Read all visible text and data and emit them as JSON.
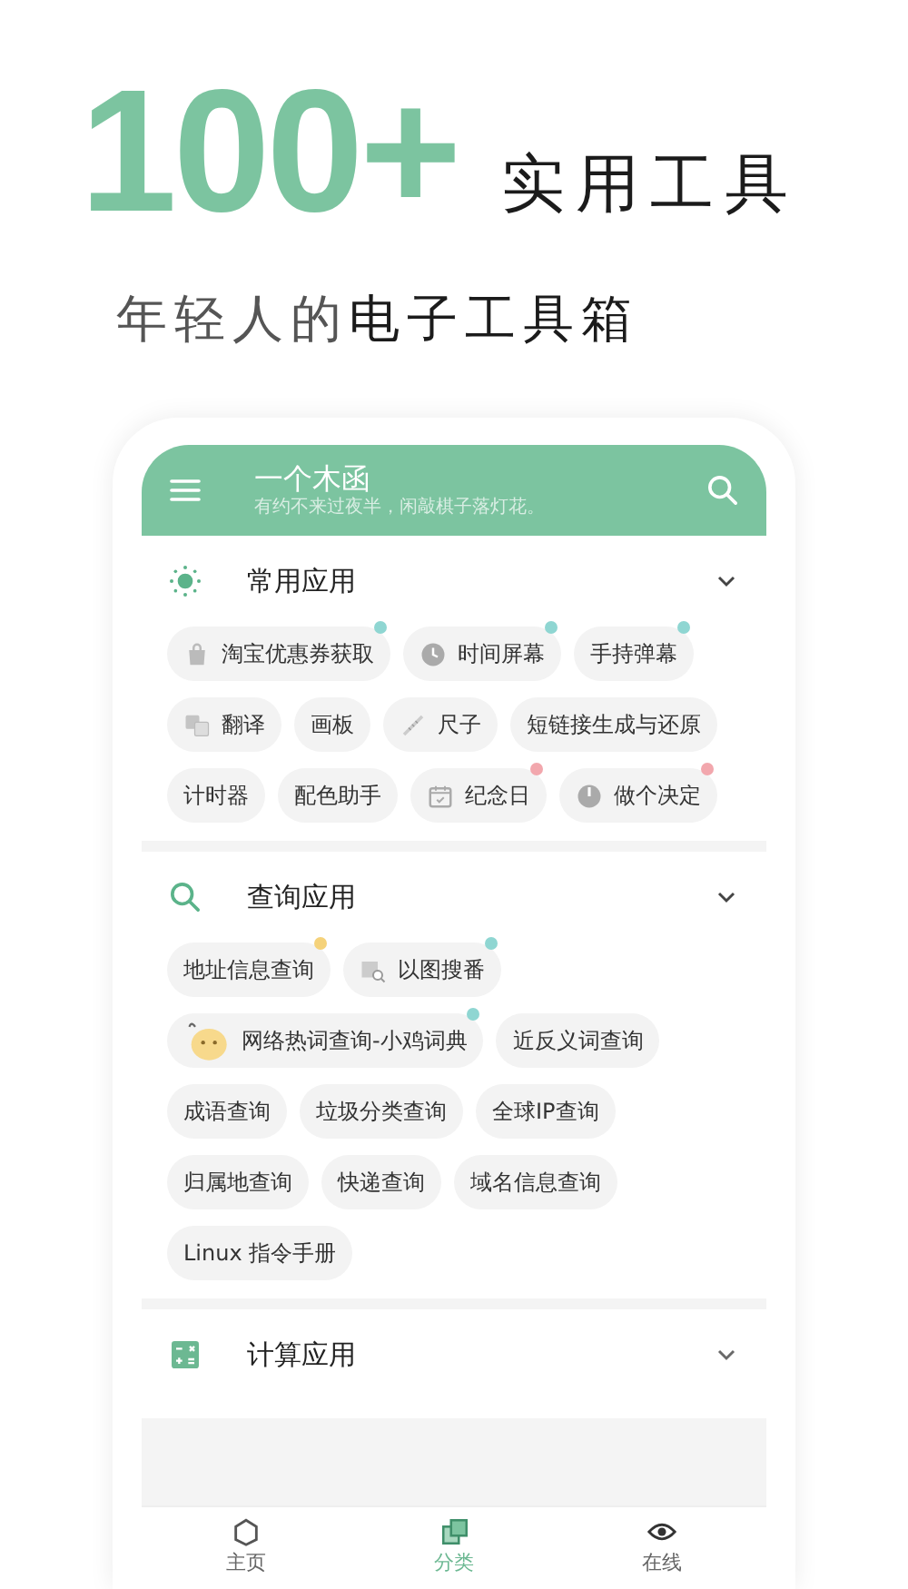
{
  "headline": {
    "number": "100+",
    "caption": "实用工具"
  },
  "subtitle": {
    "muted": "年轻人的",
    "strong": "电子工具箱"
  },
  "app_bar": {
    "title": "一个木函",
    "motto": "有约不来过夜半，闲敲棋子落灯花。"
  },
  "sections": [
    {
      "kind": "sun",
      "title": "常用应用",
      "expanded": true,
      "chips": [
        {
          "label": "淘宝优惠券获取",
          "kind": "bag",
          "color": "#8fd6d2"
        },
        {
          "label": "时间屏幕",
          "kind": "clock",
          "color": "#8fd6d2"
        },
        {
          "label": "手持弹幕",
          "kind": "plain",
          "color": "#8fd6d2"
        },
        {
          "label": "翻译",
          "kind": "translate"
        },
        {
          "label": "画板",
          "kind": "plain"
        },
        {
          "label": "尺子",
          "kind": "ruler"
        },
        {
          "label": "短链接生成与还原",
          "kind": "plain"
        },
        {
          "label": "计时器",
          "kind": "plain"
        },
        {
          "label": "配色助手",
          "kind": "plain"
        },
        {
          "label": "纪念日",
          "kind": "calendar",
          "color": "#f2a7ad"
        },
        {
          "label": "做个决定",
          "kind": "dial",
          "color": "#f2a7ad"
        }
      ]
    },
    {
      "kind": "search",
      "title": "查询应用",
      "expanded": true,
      "chips": [
        {
          "label": "地址信息查询",
          "kind": "plain",
          "color": "#f5d27a"
        },
        {
          "label": "以图搜番",
          "kind": "image-search",
          "color": "#8fd6d2"
        },
        {
          "label": "网络热词查询-小鸡词典",
          "kind": "chick",
          "color": "#8fd6d2"
        },
        {
          "label": "近反义词查询",
          "kind": "plain"
        },
        {
          "label": "成语查询",
          "kind": "plain"
        },
        {
          "label": "垃圾分类查询",
          "kind": "plain"
        },
        {
          "label": "全球IP查询",
          "kind": "plain"
        },
        {
          "label": "归属地查询",
          "kind": "plain"
        },
        {
          "label": "快递查询",
          "kind": "plain"
        },
        {
          "label": "域名信息查询",
          "kind": "plain"
        },
        {
          "label": "Linux 指令手册",
          "kind": "plain"
        }
      ]
    },
    {
      "kind": "calculator",
      "title": "计算应用",
      "expanded": false
    }
  ],
  "bottom_nav": [
    {
      "label": "主页",
      "kind": "home",
      "selected": false
    },
    {
      "label": "分类",
      "kind": "category",
      "selected": true
    },
    {
      "label": "在线",
      "kind": "eye",
      "selected": false
    }
  ]
}
